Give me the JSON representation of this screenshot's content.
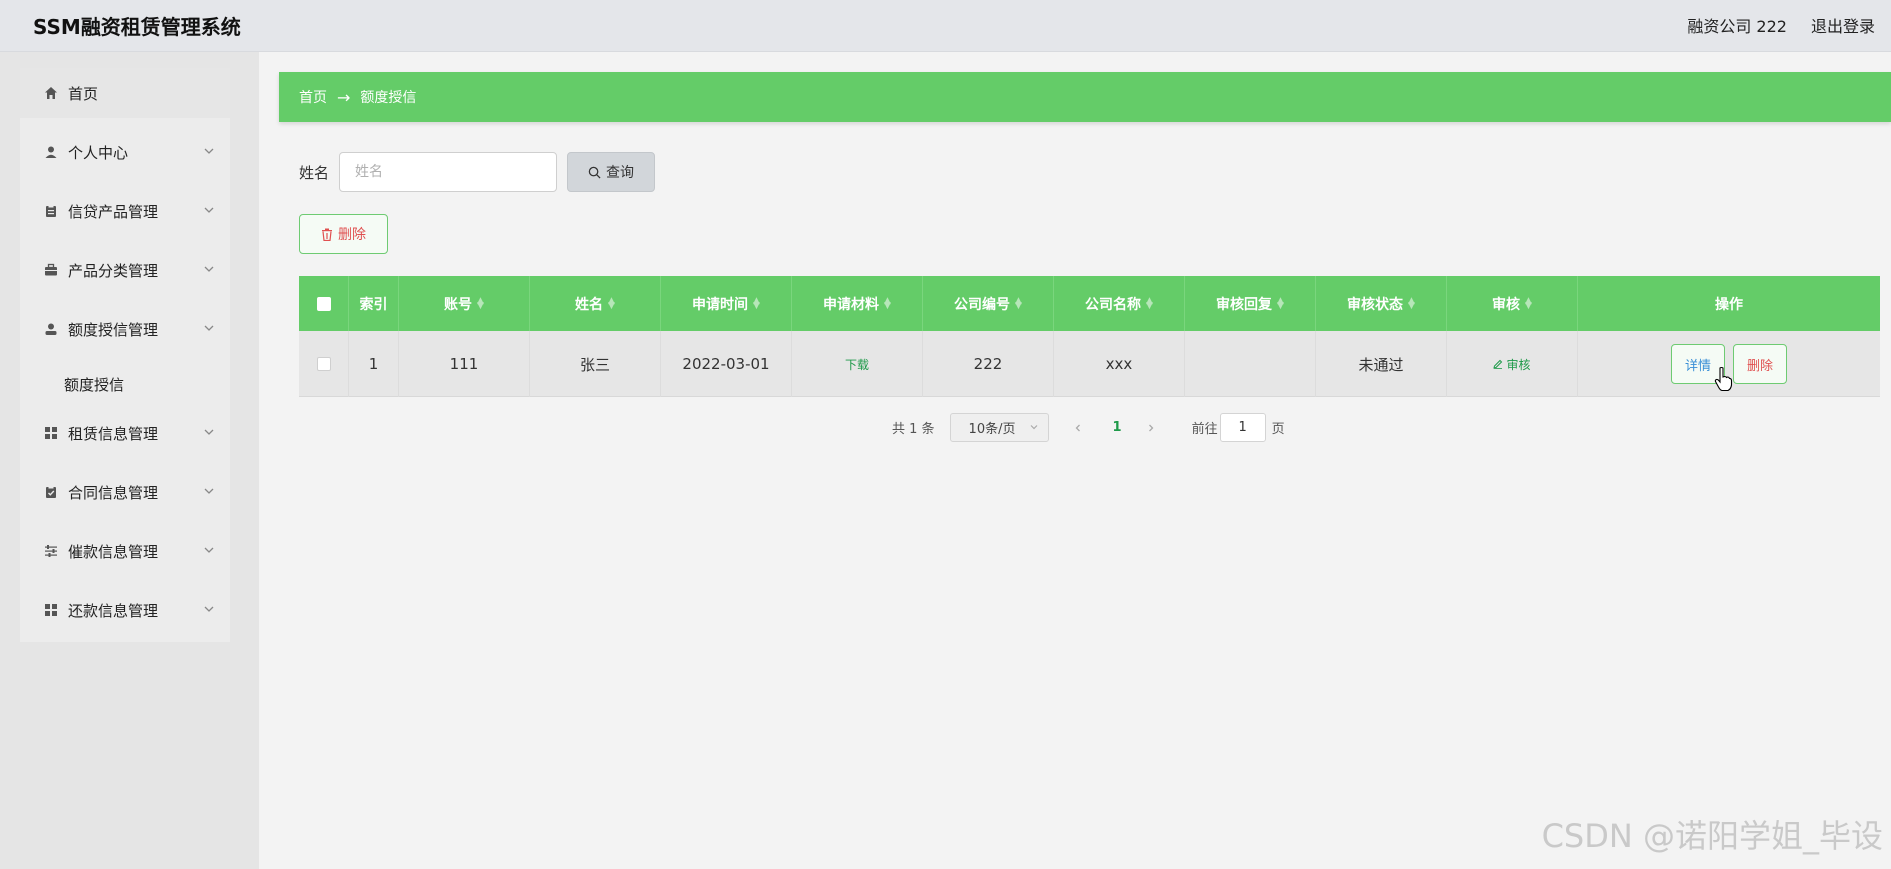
{
  "header": {
    "app_title": "SSM融资租赁管理系统",
    "user": "融资公司 222",
    "logout": "退出登录"
  },
  "sidebar": {
    "items": [
      {
        "label": "首页",
        "icon": "home-icon"
      },
      {
        "label": "个人中心",
        "icon": "user-icon"
      },
      {
        "label": "信贷产品管理",
        "icon": "clipboard-icon"
      },
      {
        "label": "产品分类管理",
        "icon": "briefcase-icon"
      },
      {
        "label": "额度授信管理",
        "icon": "person-icon"
      },
      {
        "label": "租赁信息管理",
        "icon": "grid-icon"
      },
      {
        "label": "合同信息管理",
        "icon": "check-clipboard-icon"
      },
      {
        "label": "催款信息管理",
        "icon": "sliders-icon"
      },
      {
        "label": "还款信息管理",
        "icon": "grid-icon"
      }
    ],
    "sub_item": "额度授信"
  },
  "breadcrumb": {
    "home": "首页",
    "current": "额度授信"
  },
  "search": {
    "label": "姓名",
    "placeholder": "姓名",
    "button": "查询"
  },
  "toolbar": {
    "delete": "删除"
  },
  "table": {
    "columns": [
      "索引",
      "账号",
      "姓名",
      "申请时间",
      "申请材料",
      "公司编号",
      "公司名称",
      "审核回复",
      "审核状态",
      "审核",
      "操作"
    ],
    "rows": [
      {
        "index": "1",
        "account": "111",
        "name": "张三",
        "apply_time": "2022-03-01",
        "material": "下载",
        "company_no": "222",
        "company_name": "xxx",
        "reply": "",
        "status": "未通过",
        "audit": "审核",
        "detail": "详情",
        "delete": "删除"
      }
    ]
  },
  "pagination": {
    "total": "共 1 条",
    "page_size": "10条/页",
    "current": "1",
    "goto_label": "前往",
    "goto_value": "1",
    "suffix": "页"
  },
  "watermark": "CSDN @诺阳学姐_毕设"
}
